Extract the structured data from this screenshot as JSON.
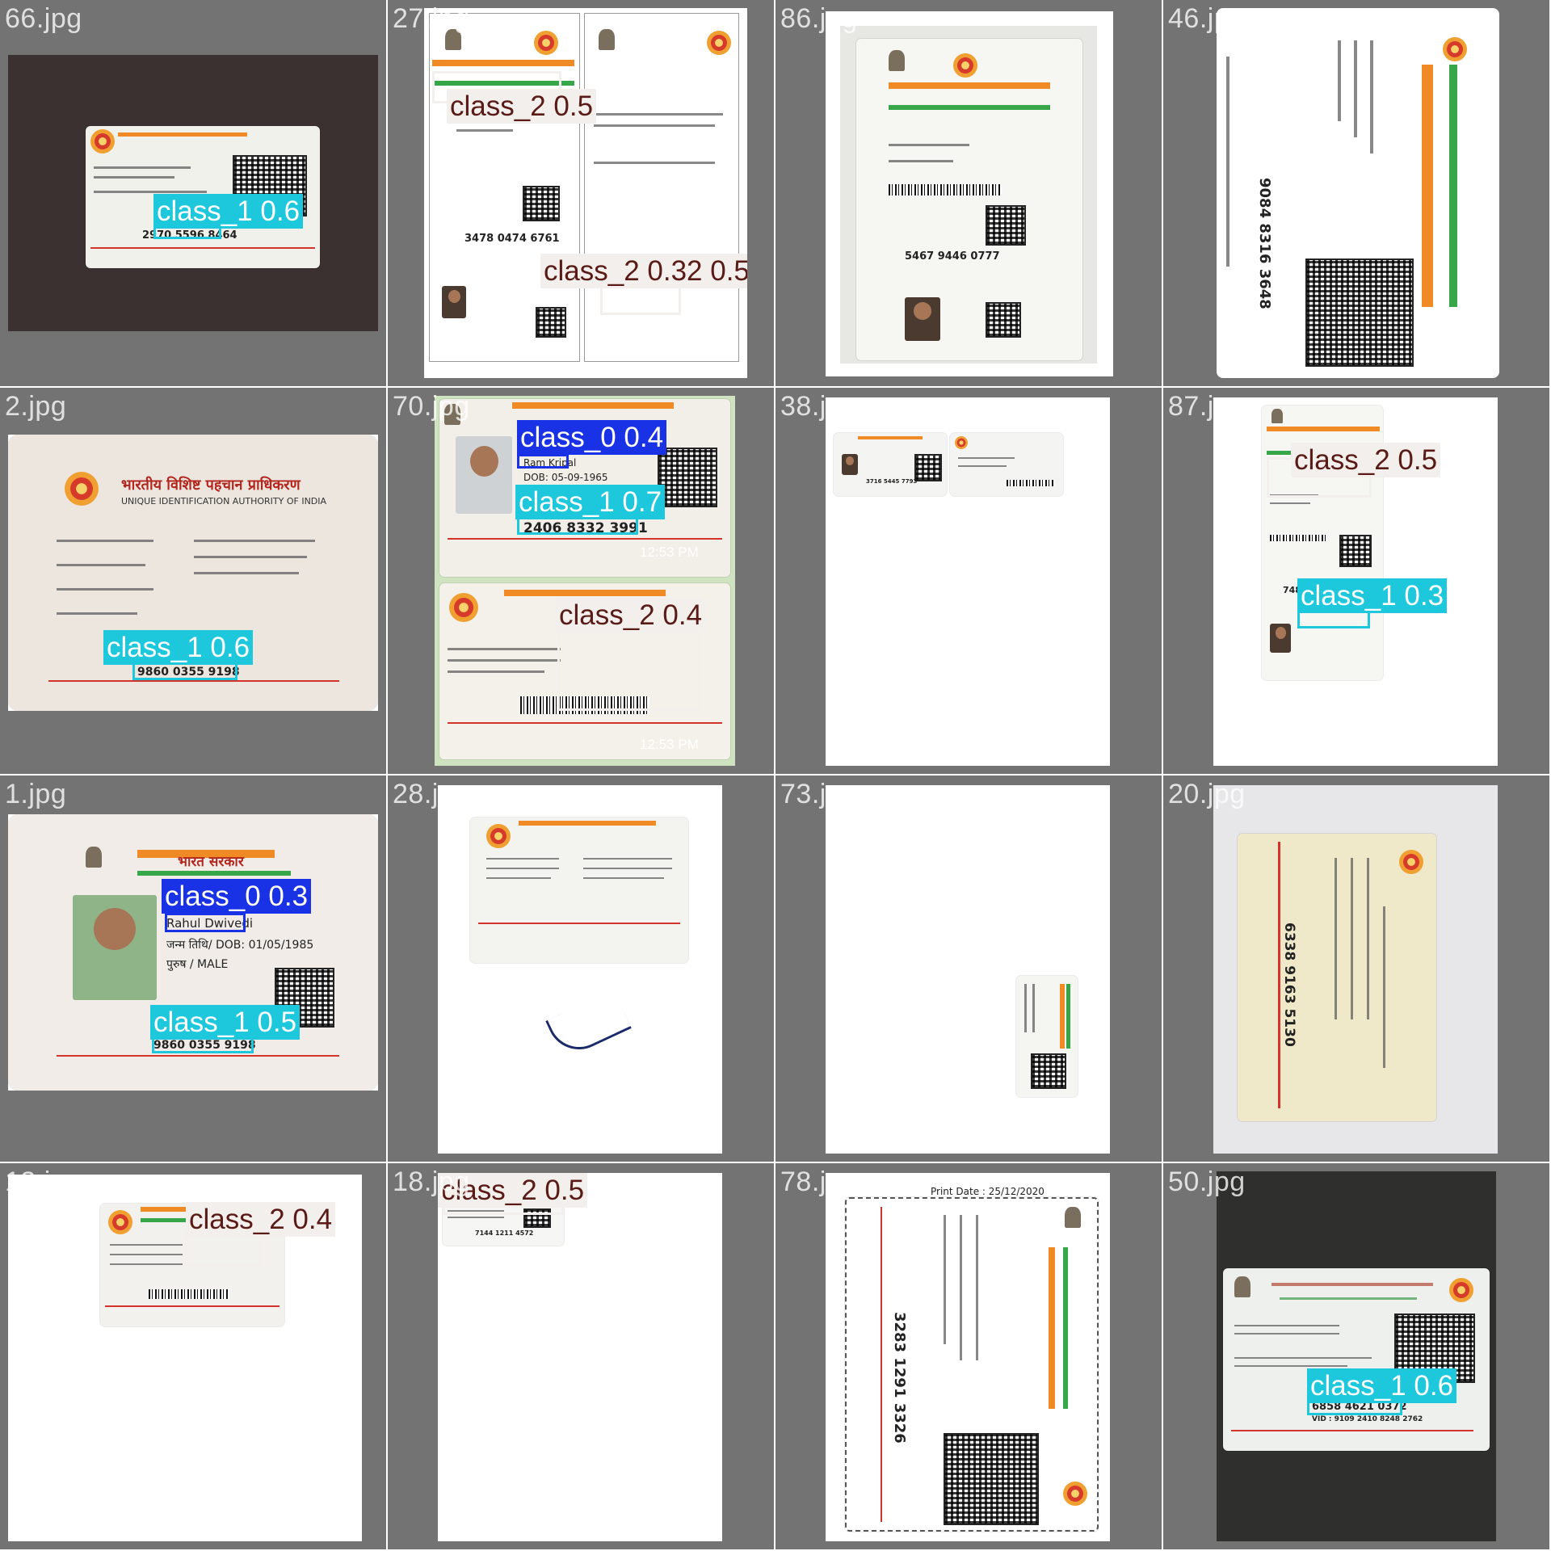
{
  "tiles": [
    {
      "filename": "66.jpg"
    },
    {
      "filename": "27.jpg"
    },
    {
      "filename": "86.jpg"
    },
    {
      "filename": "46.jpg"
    },
    {
      "filename": "2.jpg"
    },
    {
      "filename": "70.jpg"
    },
    {
      "filename": "38.jpg"
    },
    {
      "filename": "87.jpg"
    },
    {
      "filename": "1.jpg"
    },
    {
      "filename": "28.jpg"
    },
    {
      "filename": "73.jpg"
    },
    {
      "filename": "20.jpg"
    },
    {
      "filename": "13.jpg"
    },
    {
      "filename": "18.jpg"
    },
    {
      "filename": "78.jpg"
    },
    {
      "filename": "50.jpg"
    }
  ],
  "detections": {
    "t66_a": "class_1 0.6",
    "t27_a": "class_2 0.5",
    "t27_b": "class_2 0.32 0.5",
    "t2_a": "class_1 0.6",
    "t70_a": "class_0 0.4",
    "t70_b": "class_1 0.7",
    "t70_c": "class_2 0.4",
    "t87_a": "class_2 0.5",
    "t87_b": "class_1 0.3",
    "t1_a": "class_0 0.3",
    "t1_b": "class_1 0.5",
    "t13_a": "class_2 0.4",
    "t18_a": "class_2 0.5",
    "t50_a": "class_1 0.6"
  },
  "card_text": {
    "t66_number": "2970 5596 8464",
    "t27_number": "3478 0474 6761",
    "t86_number": "5467 9446 0777",
    "t46_number": "9084 8316 3648",
    "t2_number": "9860 0355 9198",
    "t70_number": "2406 8332 3991",
    "t70_name": "Ram Kripal",
    "t70_dob": "DOB: 05-09-1965",
    "t70_time1": "12:53 PM",
    "t70_time2": "12:53 PM",
    "t38_number": "3716 5445 7793",
    "t87_number": "7485 3087 3213",
    "t1_name": "Rahul Dwivedi",
    "t1_dob": "जन्म तिथि/ DOB: 01/05/1985",
    "t1_gender": "पुरुष / MALE",
    "t1_number": "9860 0355 9198",
    "t1_title": "भारत सरकार",
    "t20_number": "6338 9163 5130",
    "t13_number": "",
    "t18_number": "7144 1211 4572",
    "t78_print": "Print Date : 25/12/2020",
    "t78_number": "3283 1291 3326",
    "t50_number": "6858 4621 0372",
    "t50_vid": "VID : 9109 2410 8248 2762",
    "t2_title": "भारतीय विशिष्ट पहचान प्राधिकरण",
    "t2_subtitle": "UNIQUE IDENTIFICATION AUTHORITY OF INDIA"
  },
  "colors": {
    "class_0": "#1932e6",
    "class_1": "#1ec8dc",
    "class_2": "#f2efec",
    "tile_bg": "#737373"
  }
}
